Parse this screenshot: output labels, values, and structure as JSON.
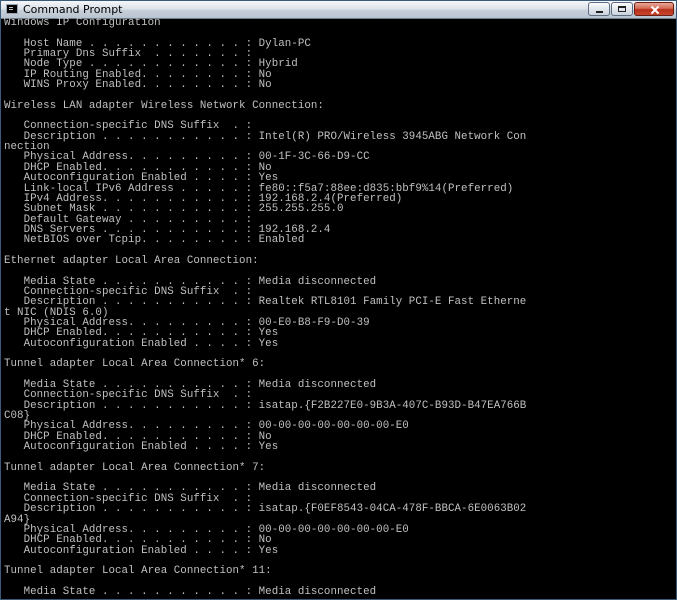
{
  "window": {
    "title": "Command Prompt",
    "icon": "cmd-icon",
    "buttons": {
      "minimize": "minimize-icon",
      "maximize": "maximize-icon",
      "close": "close-icon"
    }
  },
  "console": {
    "lines": [
      "Windows IP Configuration",
      "",
      "   Host Name . . . . . . . . . . . . : Dylan-PC",
      "   Primary Dns Suffix  . . . . . . . :",
      "   Node Type . . . . . . . . . . . . : Hybrid",
      "   IP Routing Enabled. . . . . . . . : No",
      "   WINS Proxy Enabled. . . . . . . . : No",
      "",
      "Wireless LAN adapter Wireless Network Connection:",
      "",
      "   Connection-specific DNS Suffix  . :",
      "   Description . . . . . . . . . . . : Intel(R) PRO/Wireless 3945ABG Network Con",
      "nection",
      "   Physical Address. . . . . . . . . : 00-1F-3C-66-D9-CC",
      "   DHCP Enabled. . . . . . . . . . . : No",
      "   Autoconfiguration Enabled . . . . : Yes",
      "   Link-local IPv6 Address . . . . . : fe80::f5a7:88ee:d835:bbf9%14(Preferred)",
      "   IPv4 Address. . . . . . . . . . . : 192.168.2.4(Preferred)",
      "   Subnet Mask . . . . . . . . . . . : 255.255.255.0",
      "   Default Gateway . . . . . . . . . :",
      "   DNS Servers . . . . . . . . . . . : 192.168.2.4",
      "   NetBIOS over Tcpip. . . . . . . . : Enabled",
      "",
      "Ethernet adapter Local Area Connection:",
      "",
      "   Media State . . . . . . . . . . . : Media disconnected",
      "   Connection-specific DNS Suffix  . :",
      "   Description . . . . . . . . . . . : Realtek RTL8101 Family PCI-E Fast Etherne",
      "t NIC (NDIS 6.0)",
      "   Physical Address. . . . . . . . . : 00-E0-B8-F9-D0-39",
      "   DHCP Enabled. . . . . . . . . . . : Yes",
      "   Autoconfiguration Enabled . . . . : Yes",
      "",
      "Tunnel adapter Local Area Connection* 6:",
      "",
      "   Media State . . . . . . . . . . . : Media disconnected",
      "   Connection-specific DNS Suffix  . :",
      "   Description . . . . . . . . . . . : isatap.{F2B227E0-9B3A-407C-B93D-B47EA766B",
      "C08}",
      "   Physical Address. . . . . . . . . : 00-00-00-00-00-00-00-E0",
      "   DHCP Enabled. . . . . . . . . . . : No",
      "   Autoconfiguration Enabled . . . . : Yes",
      "",
      "Tunnel adapter Local Area Connection* 7:",
      "",
      "   Media State . . . . . . . . . . . : Media disconnected",
      "   Connection-specific DNS Suffix  . :",
      "   Description . . . . . . . . . . . : isatap.{F0EF8543-04CA-478F-BBCA-6E0063B02",
      "A94}",
      "   Physical Address. . . . . . . . . : 00-00-00-00-00-00-00-E0",
      "   DHCP Enabled. . . . . . . . . . . : No",
      "   Autoconfiguration Enabled . . . . : Yes",
      "",
      "Tunnel adapter Local Area Connection* 11:",
      "",
      "   Media State . . . . . . . . . . . : Media disconnected"
    ]
  }
}
